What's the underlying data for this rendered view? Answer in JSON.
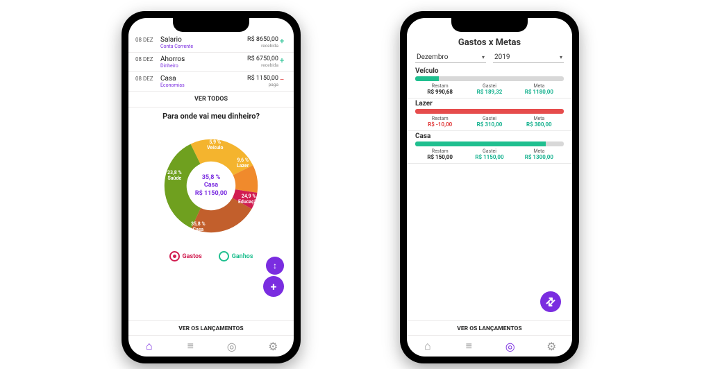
{
  "left": {
    "transactions": [
      {
        "date": "08 DEZ",
        "title": "Salario",
        "account": "Conta Corrente",
        "amount": "R$ 8650,00",
        "status": "recebida",
        "dir": "in"
      },
      {
        "date": "08 DEZ",
        "title": "Ahorros",
        "account": "Dinheiro",
        "amount": "R$ 6750,00",
        "status": "recebida",
        "dir": "in"
      },
      {
        "date": "08 DEZ",
        "title": "Casa",
        "account": "Economias",
        "amount": "R$ 1150,00",
        "status": "paga",
        "dir": "out"
      }
    ],
    "ver_todos": "VER TODOS",
    "chart_title": "Para onde vai meu dinheiro?",
    "center": {
      "pct": "35,8 %",
      "label": "Casa",
      "value": "R$ 1150,00"
    },
    "legend": {
      "gastos": "Gastos",
      "ganhos": "Ganhos"
    },
    "ver_lanc": "VER OS LANÇAMENTOS",
    "nav": {
      "home": "home",
      "list": "list",
      "target": "target",
      "settings": "settings"
    }
  },
  "right": {
    "title": "Gastos x Metas",
    "filters": {
      "month": "Dezembro",
      "year": "2019"
    },
    "cols": {
      "restam": "Restam",
      "gastei": "Gastei",
      "meta": "Meta"
    },
    "goals": [
      {
        "name": "Veículo",
        "fill": 16,
        "color": "#1fbf8f",
        "restam": "R$ 990,68",
        "restam_cls": "",
        "gastei": "R$ 189,32",
        "meta": "R$ 1180,00"
      },
      {
        "name": "Lazer",
        "fill": 100,
        "color": "#e64c4c",
        "restam": "R$ -10,00",
        "restam_cls": "red",
        "gastei": "R$ 310,00",
        "meta": "R$ 300,00"
      },
      {
        "name": "Casa",
        "fill": 88,
        "color": "#1fbf8f",
        "restam": "R$ 150,00",
        "restam_cls": "",
        "gastei": "R$ 1150,00",
        "meta": "R$ 1300,00"
      }
    ],
    "ver_lanc": "VER OS LANÇAMENTOS"
  },
  "chart_data": {
    "type": "pie",
    "title": "Para onde vai meu dinheiro?",
    "series": [
      {
        "name": "Casa",
        "pct": 35.8,
        "color": "#6fa01f",
        "value": "R$ 1150,00"
      },
      {
        "name": "Educação",
        "pct": 24.9,
        "color": "#f4b42e"
      },
      {
        "name": "Lazer",
        "pct": 9.6,
        "color": "#f08a2c"
      },
      {
        "name": "Veículo",
        "pct": 5.9,
        "color": "#d11d50"
      },
      {
        "name": "Saúde",
        "pct": 23.8,
        "color": "#c25f2c"
      }
    ],
    "highlight": {
      "name": "Casa",
      "pct": 35.8,
      "value": "R$ 1150,00"
    }
  }
}
